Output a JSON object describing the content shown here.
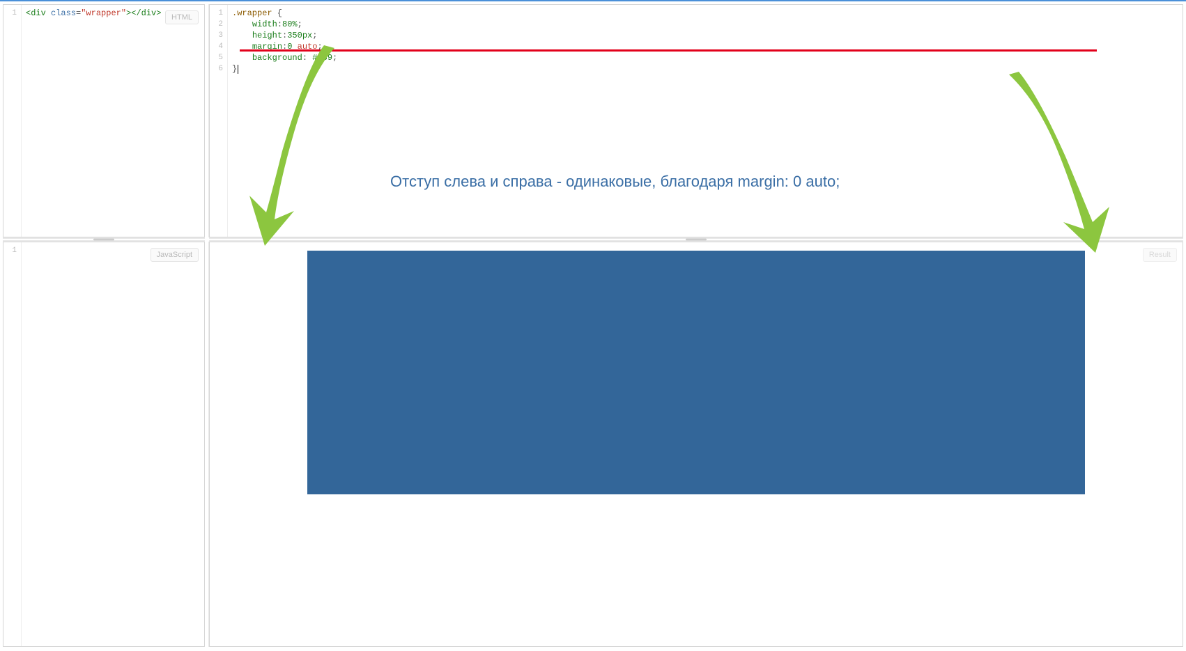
{
  "panels": {
    "html": {
      "label": "HTML",
      "line_numbers": [
        "1"
      ],
      "code": {
        "open_tag": "<div",
        "attr_name": "class",
        "attr_equals": "=",
        "attr_value": "\"wrapper\"",
        "open_close": ">",
        "close_tag": "</div>"
      }
    },
    "css": {
      "line_numbers": [
        "1",
        "2",
        "3",
        "4",
        "5",
        "6"
      ],
      "lines": [
        {
          "selector": ".wrapper",
          "brace": " {"
        },
        {
          "prop": "width",
          "colon": ":",
          "val": "80%",
          "semi": ";"
        },
        {
          "prop": "height",
          "colon": ":",
          "val": "350px",
          "semi": ";"
        },
        {
          "prop": "margin",
          "colon": ":",
          "val_num": "0 ",
          "val_kw": "auto",
          "semi": ";"
        },
        {
          "prop": "background",
          "colon": ": ",
          "val": "#369",
          "semi": ";"
        },
        {
          "brace_close": "}"
        }
      ]
    },
    "js": {
      "label": "JavaScript",
      "line_numbers": [
        "1"
      ]
    },
    "result": {
      "label": "Result",
      "box_color": "#336699"
    }
  },
  "annotation_text": "Отступ слева и справа - одинаковые, благодаря margin: 0 auto;"
}
